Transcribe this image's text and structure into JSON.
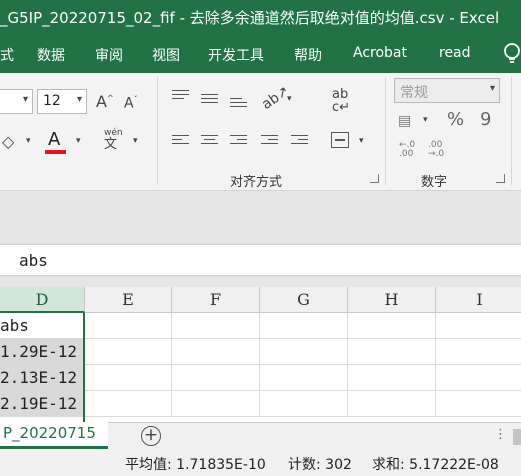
{
  "window": {
    "title": "_G5IP_20220715_02_fif - 去除多余通道然后取绝对值的均值.csv  -  Excel"
  },
  "menu": [
    "式",
    "数据",
    "审阅",
    "视图",
    "开发工具",
    "帮助",
    "Acrobat",
    "read"
  ],
  "ribbon": {
    "font_size": "12",
    "number_format": "常规",
    "font_color": "#e81123",
    "groups": {
      "alignment": "对齐方式",
      "number": "数字"
    },
    "icons": [
      "increase-font-icon",
      "decrease-font-icon",
      "fill-color-icon",
      "font-color-icon",
      "phonetic-icon",
      "top-align-icon",
      "middle-align-icon",
      "bottom-align-icon",
      "orientation-icon",
      "wrap-text-icon",
      "align-left-icon",
      "center-icon",
      "align-right-icon",
      "decrease-indent-icon",
      "increase-indent-icon",
      "merge-icon",
      "accounting-icon",
      "percent-icon",
      "comma-icon",
      "increase-decimal-icon",
      "decrease-decimal-icon",
      "lightbulb-icon"
    ],
    "glyphs": {
      "grow": "A",
      "shrink": "A",
      "color_letter": "A",
      "phonetic_top": "wén",
      "phonetic_bottom": "文",
      "wrap": "ab",
      "wrap_sub": "c",
      "percent": "%",
      "comma": "9",
      "inc_dec_top": "←.0",
      "inc_dec_bottom": ".00",
      "dec_dec_top": ".00",
      "dec_dec_bottom": "→.0"
    }
  },
  "formula_bar": {
    "content": "abs"
  },
  "grid": {
    "columns": [
      "D",
      "E",
      "F",
      "G",
      "H",
      "I"
    ],
    "active_column": "D",
    "column_d_values": [
      "abs",
      "1.29E-12",
      "2.13E-12",
      "2.19E-12"
    ]
  },
  "sheet": {
    "tab_name": "P_20220715",
    "add_label": "+",
    "more_label": "⋮"
  },
  "status": {
    "average": "平均值: 1.71835E-10",
    "count": "计数: 302",
    "sum": "求和: 5.17222E-08"
  }
}
